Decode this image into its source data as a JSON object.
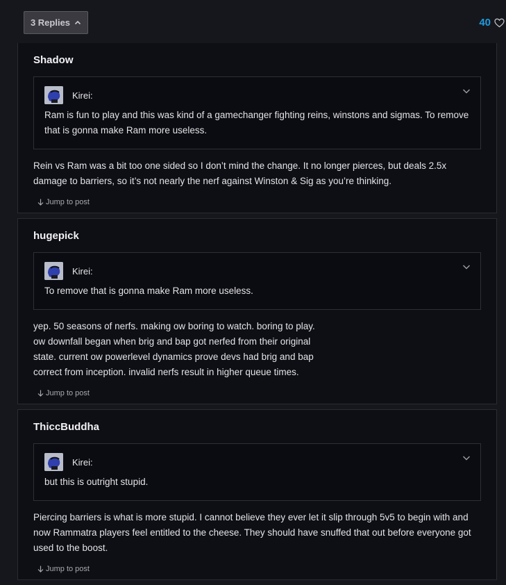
{
  "thread": {
    "replies_label": "3 Replies",
    "like_count": "40"
  },
  "posts": [
    {
      "author": "Shadow",
      "quote": {
        "author": "Kirei:",
        "text": "Ram is fun to play and this was kind of a gamechanger fighting reins, winstons and sigmas. To remove that is gonna make Ram more useless."
      },
      "body": "Rein vs Ram was a bit too one sided so I don’t mind the change. It no longer pierces, but deals 2.5x damage to barriers, so it’s not nearly the nerf against Winston & Sig as you’re thinking.",
      "jump_label": "Jump to post"
    },
    {
      "author": "hugepick",
      "quote": {
        "author": "Kirei:",
        "text": "To remove that is gonna make Ram more useless."
      },
      "body_lines": [
        "yep. 50 seasons of nerfs. making ow boring to watch. boring to play.",
        "ow downfall began when brig and bap got nerfed from their original",
        "state. current ow powerlevel dynamics prove devs had brig and bap",
        "correct from inception. invalid nerfs result in higher queue times."
      ],
      "jump_label": "Jump to post"
    },
    {
      "author": "ThiccBuddha",
      "quote": {
        "author": "Kirei:",
        "text": "but this is outright stupid."
      },
      "body": "Piercing barriers is what is more stupid. I cannot believe they ever let it slip through 5v5 to begin with and now Rammatra players feel entitled to the cheese. They should have snuffed that out before everyone got used to the boost.",
      "jump_label": "Jump to post"
    }
  ],
  "colors": {
    "accent": "#1f9bde",
    "post_bg": "#0e0f15",
    "quote_bg": "#0b0c11",
    "page_bg": "#16171d"
  },
  "icons": {
    "replies_toggle": "chevron-up-icon",
    "like": "heart-icon",
    "quote_expand": "chevron-down-icon",
    "jump": "arrow-down-icon"
  }
}
